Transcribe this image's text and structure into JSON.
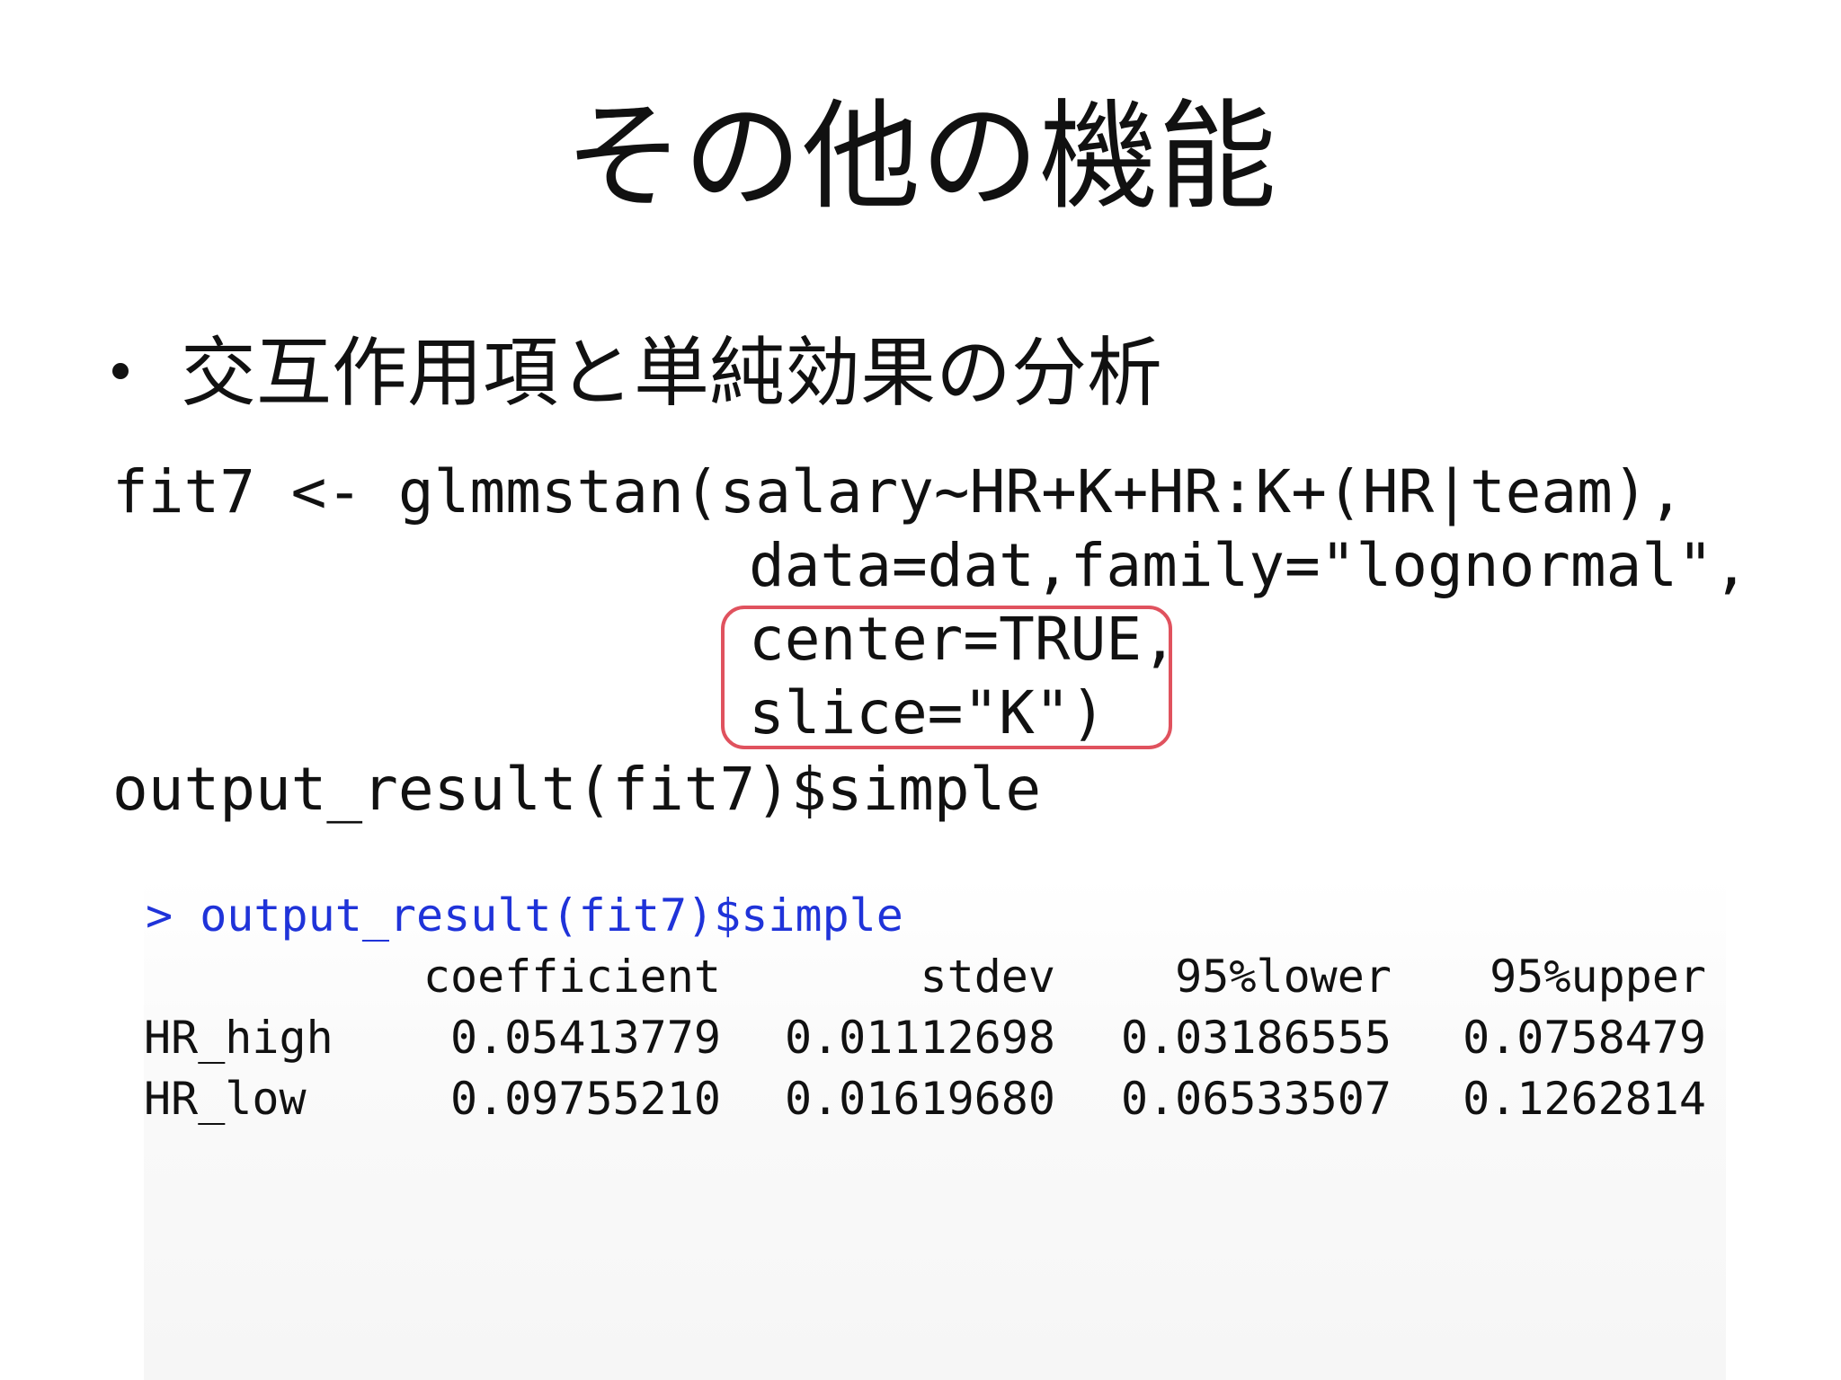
{
  "slide": {
    "title": "その他の機能",
    "bullet": "交互作用項と単純効果の分析"
  },
  "code": {
    "line1": "fit7 <- glmmstan(salary~HR+K+HR:K+(HR|team),",
    "line2": "data=dat,family=\"lognormal\",",
    "line3": "center=TRUE,",
    "line4": "slice=\"K\")",
    "line5": "output_result(fit7)$simple"
  },
  "console": {
    "prompt": "> output_result(fit7)$simple",
    "prompt_color": "#1f33d9",
    "columns": [
      "",
      "coefficient",
      "stdev",
      "95%lower",
      "95%upper"
    ],
    "rows": [
      {
        "name": "HR_high",
        "coefficient": "0.05413779",
        "stdev": "0.01112698",
        "lower": "0.03186555",
        "upper": "0.0758479"
      },
      {
        "name": "HR_low",
        "coefficient": "0.09755210",
        "stdev": "0.01619680",
        "lower": "0.06533507",
        "upper": "0.1262814"
      }
    ]
  },
  "colors": {
    "highlight_box": "#e0525e"
  }
}
